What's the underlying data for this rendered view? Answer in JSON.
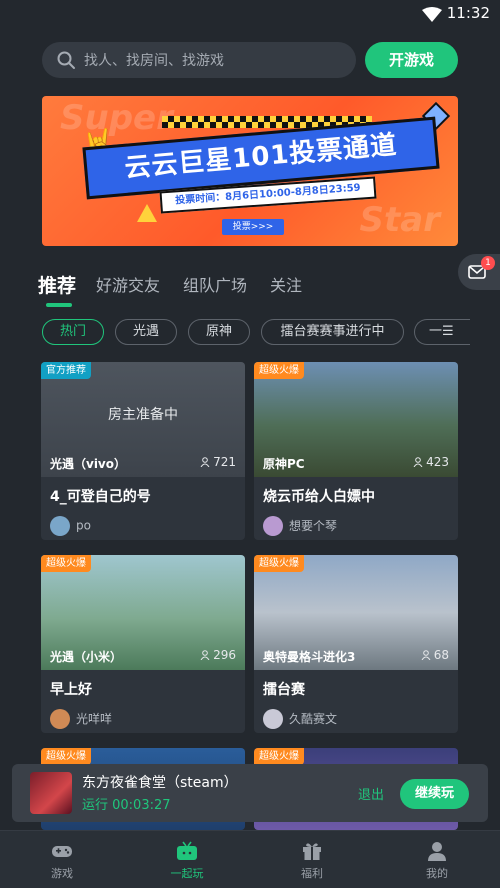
{
  "status_bar": {
    "time": "11:32"
  },
  "search": {
    "placeholder": "找人、找房间、找游戏"
  },
  "start_button": "开游戏",
  "banner": {
    "bg_word_1": "Super",
    "bg_word_2": "Star",
    "title": "云云巨星101投票通道",
    "time_text": "投票时间：8月6日10:00-8月8日23:59",
    "vote_button": "投票>>>"
  },
  "message_float": {
    "badge": "1"
  },
  "tabs": [
    {
      "label": "推荐",
      "active": true
    },
    {
      "label": "好游交友"
    },
    {
      "label": "组队广场"
    },
    {
      "label": "关注"
    }
  ],
  "chips": [
    {
      "label": "热门",
      "active": true
    },
    {
      "label": "光遇"
    },
    {
      "label": "原神"
    },
    {
      "label": "擂台赛赛事进行中"
    },
    {
      "label": "一☰"
    }
  ],
  "cards": [
    {
      "tag": "官方推荐",
      "tag_type": "official",
      "center_text": "房主准备中",
      "game": "光遇（vivo）",
      "count": "721",
      "room": "4_可登自己的号",
      "host": "po"
    },
    {
      "tag": "超级火爆",
      "tag_type": "hot",
      "game": "原神PC",
      "count": "423",
      "room": "烧云币给人白嫖中",
      "host": "想要个琴"
    },
    {
      "tag": "超级火爆",
      "tag_type": "hot",
      "game": "光遇（小米）",
      "count": "296",
      "room": "早上好",
      "host": "光咩咩"
    },
    {
      "tag": "超级火爆",
      "tag_type": "hot",
      "game": "奥特曼格斗进化3",
      "count": "68",
      "room": "擂台赛",
      "host": "久酷赛文"
    },
    {
      "tag": "超级火爆",
      "tag_type": "hot"
    },
    {
      "tag": "超级火爆",
      "tag_type": "hot"
    }
  ],
  "now_playing": {
    "game": "东方夜雀食堂（steam）",
    "status": "运行 00:03:27",
    "quit": "退出",
    "continue": "继续玩"
  },
  "nav": [
    {
      "label": "游戏",
      "icon": "gamepad-icon"
    },
    {
      "label": "一起玩",
      "icon": "tv-icon",
      "active": true
    },
    {
      "label": "福利",
      "icon": "gift-icon"
    },
    {
      "label": "我的",
      "icon": "person-icon"
    }
  ],
  "colors": {
    "accent": "#20c57c",
    "background": "#23282e",
    "hot_tag": "#ff8a1f",
    "official_tag": "#12a0c4"
  }
}
